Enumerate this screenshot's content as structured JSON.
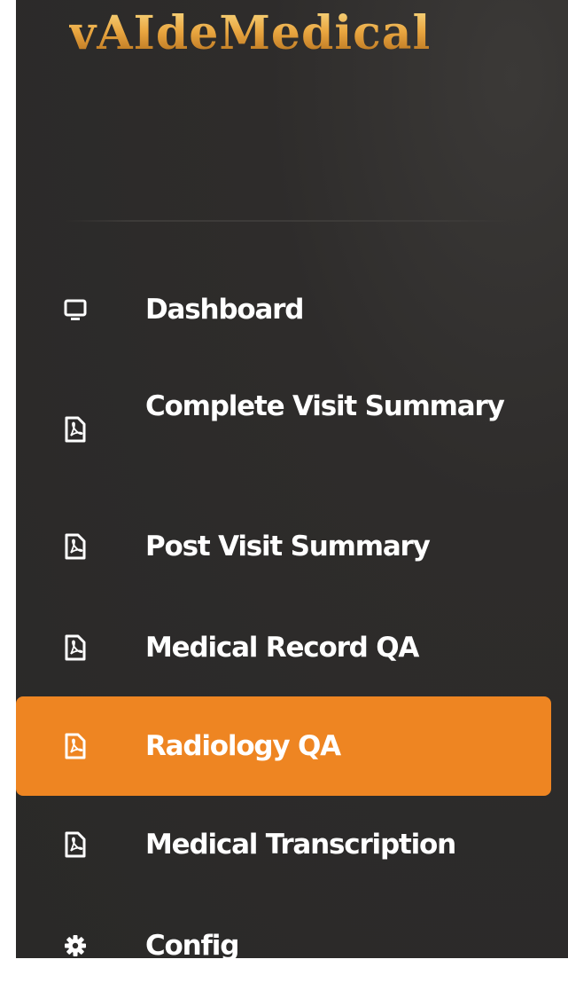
{
  "app": {
    "logo_text": "vAIdeMedical"
  },
  "nav": {
    "items": [
      {
        "label": "Dashboard",
        "icon": "monitor-icon",
        "active": false
      },
      {
        "label": "Complete Visit Summary",
        "icon": "pdf-file-icon",
        "active": false
      },
      {
        "label": "Post Visit Summary",
        "icon": "pdf-file-icon",
        "active": false
      },
      {
        "label": "Medical Record QA",
        "icon": "pdf-file-icon",
        "active": false
      },
      {
        "label": "Radiology QA",
        "icon": "pdf-file-icon",
        "active": true
      },
      {
        "label": "Medical Transcription",
        "icon": "pdf-file-icon",
        "active": false
      },
      {
        "label": "Config",
        "icon": "gear-icon",
        "active": false
      }
    ]
  },
  "colors": {
    "sidebar_bg": "#2c2b2a",
    "active_bg": "#ee8522",
    "logo_gold": "#e9a640",
    "text": "#ffffff"
  }
}
